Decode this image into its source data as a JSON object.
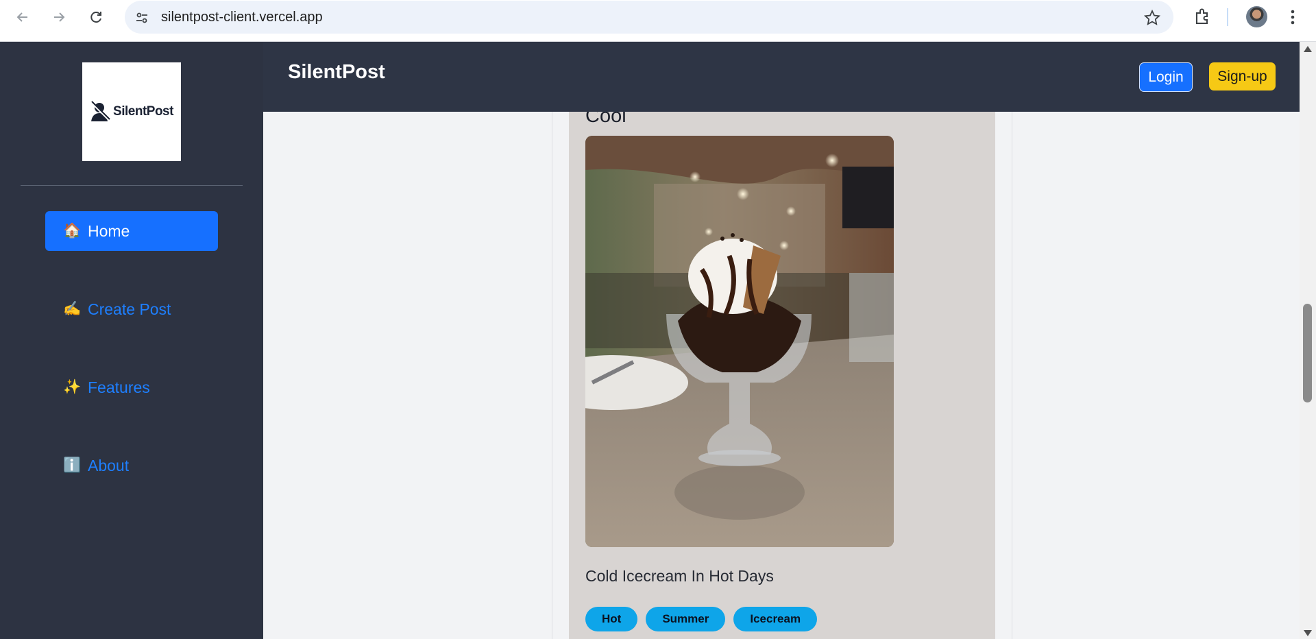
{
  "browser": {
    "url": "silentpost-client.vercel.app"
  },
  "sidebar": {
    "logo_text": "SilentPost",
    "items": [
      {
        "emoji": "🏠",
        "label": "Home",
        "active": true
      },
      {
        "emoji": "✍️",
        "label": "Create Post",
        "active": false
      },
      {
        "emoji": "✨",
        "label": "Features",
        "active": false
      },
      {
        "emoji": "ℹ️",
        "label": "About",
        "active": false
      }
    ]
  },
  "header": {
    "brand": "SilentPost",
    "login_label": "Login",
    "signup_label": "Sign-up"
  },
  "post": {
    "title": "Cool",
    "description": "Cold Icecream In Hot Days",
    "tags": [
      "Hot",
      "Summer",
      "Icecream"
    ]
  },
  "colors": {
    "sidebar_bg": "#2d3342",
    "header_bg": "#2e3545",
    "primary": "#1670ff",
    "signup": "#f6c915",
    "tag": "#0ea5e9",
    "card_bg": "#d8d4d2"
  }
}
